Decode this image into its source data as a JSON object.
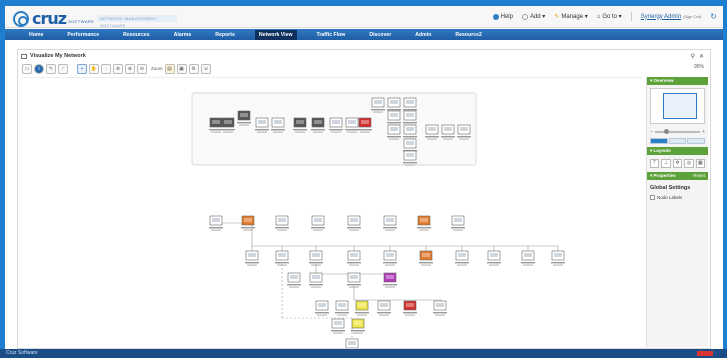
{
  "header": {
    "logo_word": "cruz",
    "logo_sub": "SOFTWARE",
    "tagline": "NETWORK MANAGEMENT SOFTWARE",
    "help": "Help",
    "add": "Add ▾",
    "manage": "Manage ▾",
    "goto": "Go to ▾",
    "user": "Synergy Admin",
    "user_sub": "(Sign Out)"
  },
  "nav": {
    "tabs": [
      {
        "label": "Home",
        "active": false
      },
      {
        "label": "Performance",
        "active": false
      },
      {
        "label": "Resources",
        "active": false
      },
      {
        "label": "Alarms",
        "active": false
      },
      {
        "label": "Reports",
        "active": false
      },
      {
        "label": "Network View",
        "active": true
      },
      {
        "label": "Traffic Flow",
        "active": false
      },
      {
        "label": "Discover",
        "active": false
      },
      {
        "label": "Admin",
        "active": false
      },
      {
        "label": "Resource2",
        "active": false
      }
    ]
  },
  "panel": {
    "title": "Visualize My Network",
    "zoom_value": "95%",
    "zoom_label": "Zoom"
  },
  "side": {
    "overview_title": "Overview",
    "layouts_title": "Layouts",
    "properties_title": "Properties",
    "properties_right": "Reset",
    "global_settings": "Global Settings",
    "show_labels": "Node Labels"
  },
  "colors": {
    "brand": "#1f5fa8",
    "nav": "#2f78c2",
    "side_green": "#5da13a",
    "node_orange": "#e07b2f",
    "node_red": "#d0302e",
    "node_purple": "#b03bb8",
    "node_yellow": "#efe64a",
    "node_navy": "#1a2c6e",
    "node_gray": "#9aa0a6"
  },
  "footer": {
    "text": "Cruz Software"
  }
}
